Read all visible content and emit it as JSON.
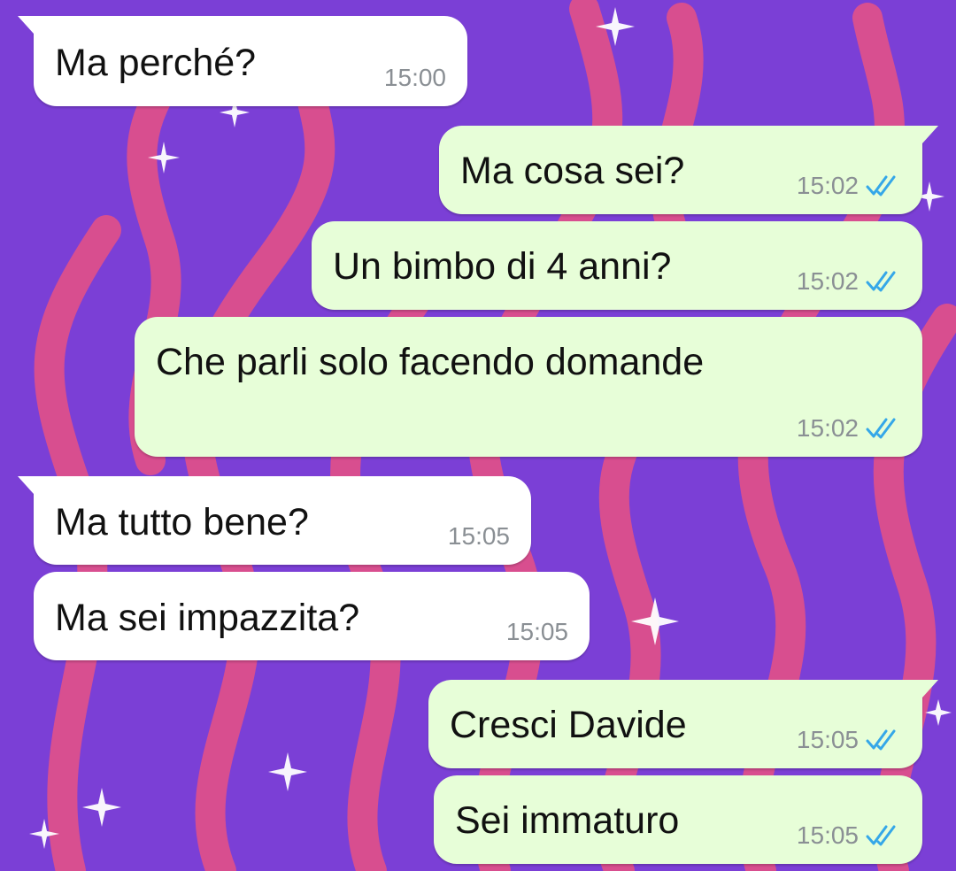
{
  "chat": {
    "messages": [
      {
        "direction": "incoming",
        "text": "Ma perché?",
        "time": "15:00"
      },
      {
        "direction": "outgoing",
        "text": "Ma cosa sei?",
        "time": "15:02",
        "status": "read"
      },
      {
        "direction": "outgoing",
        "text": "Un bimbo di 4 anni?",
        "time": "15:02",
        "status": "read"
      },
      {
        "direction": "outgoing",
        "text": "Che parli solo facendo domande",
        "time": "15:02",
        "status": "read"
      },
      {
        "direction": "incoming",
        "text": "Ma tutto bene?",
        "time": "15:05"
      },
      {
        "direction": "incoming",
        "text": "Ma sei impazzita?",
        "time": "15:05"
      },
      {
        "direction": "outgoing",
        "text": "Cresci Davide",
        "time": "15:05",
        "status": "read"
      },
      {
        "direction": "outgoing",
        "text": "Sei immaturo",
        "time": "15:05",
        "status": "read"
      }
    ]
  },
  "theme": {
    "background": "#7b3fd6",
    "flame_color": "#e0508a",
    "incoming_bubble": "#ffffff",
    "outgoing_bubble": "#e7fed8",
    "read_tick_color": "#35a7e8",
    "icons": [
      "double-check-icon",
      "sparkle-icon"
    ]
  }
}
